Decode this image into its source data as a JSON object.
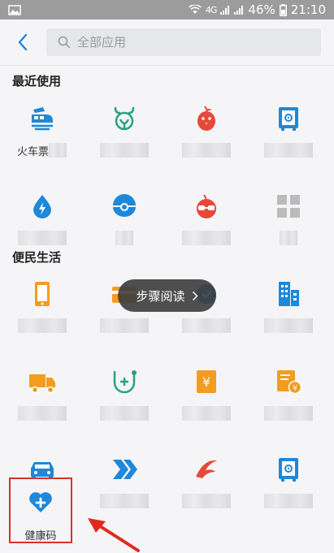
{
  "status_bar": {
    "battery_percent": "46%",
    "time": "21:10",
    "signal_text": "4G",
    "colors": {
      "background": "#9c9c9c"
    }
  },
  "app_bar": {
    "search_placeholder": "全部应用",
    "back_icon": "chevron-left-icon",
    "search_icon": "search-icon"
  },
  "sections": {
    "recent_title": "最近使用",
    "life_title": "便民生活"
  },
  "recent_items": [
    {
      "label": "火车票",
      "icon": "train-ticket-icon",
      "color": "#1e88d9"
    },
    {
      "label": "",
      "icon": "deer-icon",
      "color": "#27a37a"
    },
    {
      "label": "",
      "icon": "bird-icon",
      "color": "#e8483b"
    },
    {
      "label": "",
      "icon": "safe-icon",
      "color": "#1e88d9"
    },
    {
      "label": "",
      "icon": "water-bolt-icon",
      "color": "#1e88d9"
    },
    {
      "label": "",
      "icon": "pearl-shell-icon",
      "color": "#1e88d9"
    },
    {
      "label": "",
      "icon": "glasses-face-icon",
      "color": "#e8483b"
    },
    {
      "label": "",
      "icon": "more-grid-icon",
      "color": "#bbbbbb"
    }
  ],
  "life_items": [
    {
      "label": "",
      "icon": "phone-icon",
      "color": "#f39c1f"
    },
    {
      "label": "",
      "icon": "card-icon",
      "color": "#f39c1f"
    },
    {
      "label": "",
      "icon": "shield-bubble-icon",
      "color": "#1e88d9"
    },
    {
      "label": "",
      "icon": "building-icon",
      "color": "#1e88d9"
    },
    {
      "label": "",
      "icon": "truck-icon",
      "color": "#f39c1f"
    },
    {
      "label": "",
      "icon": "medical-shield-icon",
      "color": "#27a37a"
    },
    {
      "label": "",
      "icon": "yuan-tag-icon",
      "color": "#f39c1f"
    },
    {
      "label": "",
      "icon": "invoice-yuan-icon",
      "color": "#f39c1f"
    },
    {
      "label": "",
      "icon": "car-icon",
      "color": "#1e88d9"
    },
    {
      "label": "",
      "icon": "double-arrow-icon",
      "color": "#1e88d9"
    },
    {
      "label": "",
      "icon": "airline-icon",
      "color": "#e8483b"
    },
    {
      "label": "",
      "icon": "safe-icon",
      "color": "#1e88d9"
    }
  ],
  "health_code": {
    "label": "健康码",
    "icon": "heart-plus-icon",
    "color": "#1e88d9",
    "highlight_color": "#d8322a"
  },
  "toast": {
    "text": "步骤阅读",
    "icon": "chevron-right-icon"
  }
}
